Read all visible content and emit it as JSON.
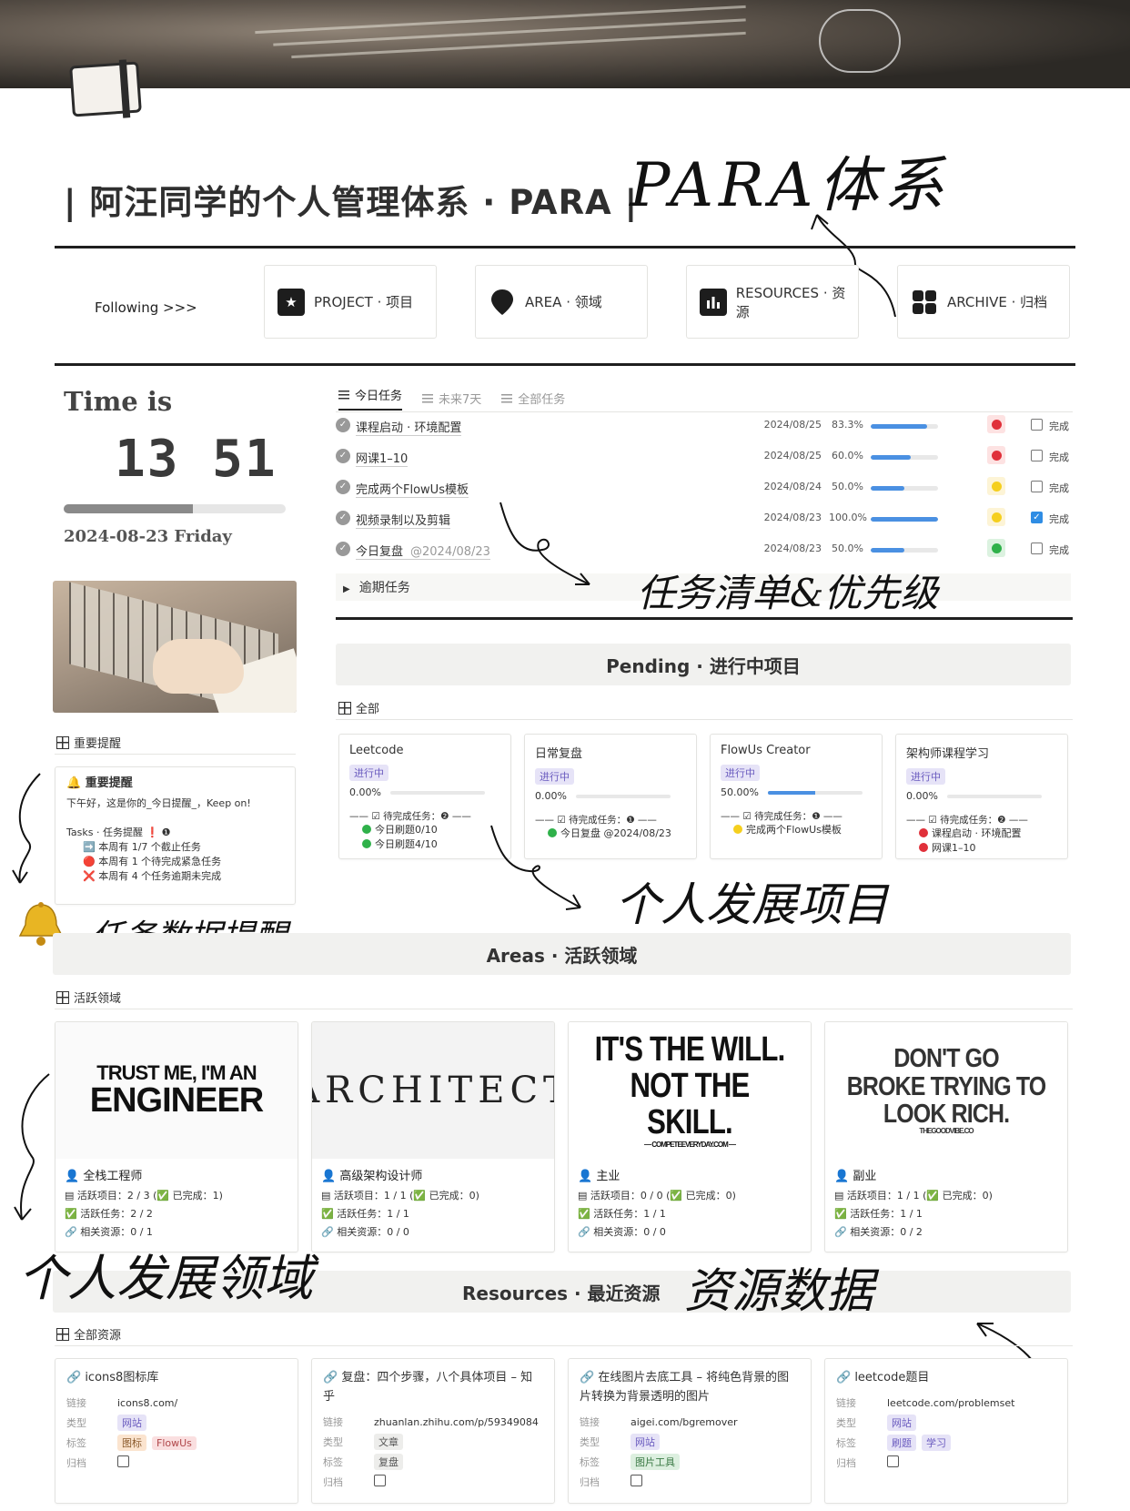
{
  "header": {
    "title": "| 阿汪同学的个人管理体系 · PARA |",
    "handwritten_title": "PARA体系"
  },
  "nav": {
    "following": "Following >>>",
    "cards": [
      {
        "label": "PROJECT · 项目",
        "icon": "folder-star-icon"
      },
      {
        "label": "AREA · 领域",
        "icon": "map-pin-icon"
      },
      {
        "label": "RESOURCES · 资源",
        "icon": "bar-chart-icon"
      },
      {
        "label": "ARCHIVE · 归档",
        "icon": "grid-icon"
      }
    ]
  },
  "clock": {
    "label": "Time is",
    "time": "13 51",
    "progress": 0.58,
    "date": "2024-08-23 Friday"
  },
  "reminder_section": {
    "tab": "重要提醒",
    "card_title": "🔔 重要提醒",
    "greeting": "下午好，这是你的_今日提醒_，Keep on!",
    "tasks_label": "Tasks · 任务提醒 ❗ ❶",
    "lines": [
      "➡️ 本周有 1/7 个截止任务",
      "🔴 本周有 1 个待完成紧急任务",
      "❌ 本周有 4 个任务逾期未完成"
    ]
  },
  "task_tabs": [
    {
      "label": "今日任务",
      "active": true
    },
    {
      "label": "未来7天",
      "active": false
    },
    {
      "label": "全部任务",
      "active": false
    }
  ],
  "tasks": [
    {
      "name": "课程启动 · 环境配置",
      "sub": "",
      "date": "2024/08/25",
      "pct_text": "83.3%",
      "pct": 0.833,
      "priority": "red",
      "done": false,
      "done_label": "完成"
    },
    {
      "name": "网课1–10",
      "sub": "",
      "date": "2024/08/25",
      "pct_text": "60.0%",
      "pct": 0.6,
      "priority": "red",
      "done": false,
      "done_label": "完成"
    },
    {
      "name": "完成两个FlowUs模板",
      "sub": "",
      "date": "2024/08/24",
      "pct_text": "50.0%",
      "pct": 0.5,
      "priority": "yellow",
      "done": false,
      "done_label": "完成"
    },
    {
      "name": "视频录制以及剪辑",
      "sub": "",
      "date": "2024/08/23",
      "pct_text": "100.0%",
      "pct": 1.0,
      "priority": "yellow",
      "done": true,
      "done_label": "完成"
    },
    {
      "name": "今日复盘",
      "sub": "@2024/08/23",
      "date": "2024/08/23",
      "pct_text": "50.0%",
      "pct": 0.5,
      "priority": "green",
      "done": false,
      "done_label": "完成"
    }
  ],
  "overdue_label": "逾期任务",
  "pending": {
    "title": "Pending · 进行中项目",
    "tab": "全部",
    "projects": [
      {
        "name": "Leetcode",
        "status": "进行中",
        "pct_text": "0.00%",
        "pct": 0.0,
        "todo_label": "—— ☑ 待完成任务：❷ ——",
        "items": [
          {
            "dot": "green",
            "text": "今日刷题0/10"
          },
          {
            "dot": "green",
            "text": "今日刷题4/10"
          }
        ]
      },
      {
        "name": "日常复盘",
        "status": "进行中",
        "pct_text": "0.00%",
        "pct": 0.0,
        "todo_label": "—— ☑ 待完成任务：❶ ——",
        "items": [
          {
            "dot": "green",
            "text": "今日复盘 @2024/08/23"
          }
        ]
      },
      {
        "name": "FlowUs Creator",
        "status": "进行中",
        "pct_text": "50.00%",
        "pct": 0.5,
        "todo_label": "—— ☑ 待完成任务：❶ ——",
        "items": [
          {
            "dot": "yellow",
            "text": "完成两个FlowUs模板"
          }
        ]
      },
      {
        "name": "架构师课程学习",
        "status": "进行中",
        "pct_text": "0.00%",
        "pct": 0.0,
        "todo_label": "—— ☑ 待完成任务：❷ ——",
        "items": [
          {
            "dot": "red",
            "text": "课程启动 · 环境配置"
          },
          {
            "dot": "red",
            "text": "网课1–10"
          }
        ]
      }
    ]
  },
  "areas": {
    "title": "Areas · 活跃领域",
    "tab": "活跃领域",
    "cards": [
      {
        "img_lines": [
          "TRUST ME, I'M AN",
          "ENGINEER"
        ],
        "name": "全栈工程师",
        "proj": "▤ 活跃项目：2 / 3 (✅ 已完成：1)",
        "task": "✅ 活跃任务：2 / 2",
        "res": "🔗 相关资源：0 / 1"
      },
      {
        "img_lines": [
          "ARCHITECT"
        ],
        "name": "高级架构设计师",
        "proj": "▤ 活跃项目：1 / 1 (✅ 已完成：0)",
        "task": "✅ 活跃任务：1 / 1",
        "res": "🔗 相关资源：0 / 0"
      },
      {
        "img_lines": [
          "IT'S THE WILL.",
          "NOT THE SKILL.",
          "— COMPETEEVERYDAY.COM —"
        ],
        "name": "主业",
        "proj": "▤ 活跃项目：0 / 0 (✅ 已完成：0)",
        "task": "✅ 活跃任务：1 / 1",
        "res": "🔗 相关资源：0 / 0"
      },
      {
        "img_lines": [
          "DON'T GO",
          "BROKE TRYING TO",
          "LOOK RICH.",
          "THEGOODVIBE.CO"
        ],
        "name": "副业",
        "proj": "▤ 活跃项目：1 / 1 (✅ 已完成：0)",
        "task": "✅ 活跃任务：1 / 1",
        "res": "🔗 相关资源：0 / 2"
      }
    ]
  },
  "resources": {
    "title": "Resources · 最近资源",
    "tab": "全部资源",
    "keys": {
      "link": "链接",
      "type": "类型",
      "tag": "标签",
      "archive": "归档"
    },
    "cards": [
      {
        "name": "🔗 icons8图标库",
        "link": "icons8.com/",
        "type": [
          {
            "t": "网站",
            "c": "purple"
          }
        ],
        "tags": [
          {
            "t": "图标",
            "c": "orange"
          },
          {
            "t": "FlowUs",
            "c": "pink"
          }
        ]
      },
      {
        "name": "🔗 复盘：四个步骤，八个具体项目 – 知乎",
        "link": "zhuanlan.zhihu.com/p/59349084",
        "type": [
          {
            "t": "文章",
            "c": "gray"
          }
        ],
        "tags": [
          {
            "t": "复盘",
            "c": "gray"
          }
        ]
      },
      {
        "name": "🔗 在线图片去底工具 – 将纯色背景的图片转换为背景透明的图片",
        "link": "aigei.com/bgremover",
        "type": [
          {
            "t": "网站",
            "c": "purple"
          }
        ],
        "tags": [
          {
            "t": "图片工具",
            "c": "green"
          }
        ]
      },
      {
        "name": "🔗 leetcode题目",
        "link": "leetcode.com/problemset",
        "type": [
          {
            "t": "网站",
            "c": "purple"
          }
        ],
        "tags": [
          {
            "t": "刷题",
            "c": "purple"
          },
          {
            "t": "学习",
            "c": "purple"
          }
        ]
      }
    ]
  },
  "annotations": {
    "tasks": "任务清单&优先级",
    "projects": "个人发展项目",
    "reminder": "任务数据提醒",
    "areas": "个人发展领域",
    "resources": "资源数据"
  },
  "colors": {
    "red": "#e0303a",
    "yellow": "#f5cf1e",
    "green": "#2fb14a",
    "red_bg": "#fde2e2",
    "yellow_bg": "#fdf4d6",
    "green_bg": "#dcf2e0",
    "accent": "#4a90e2"
  }
}
